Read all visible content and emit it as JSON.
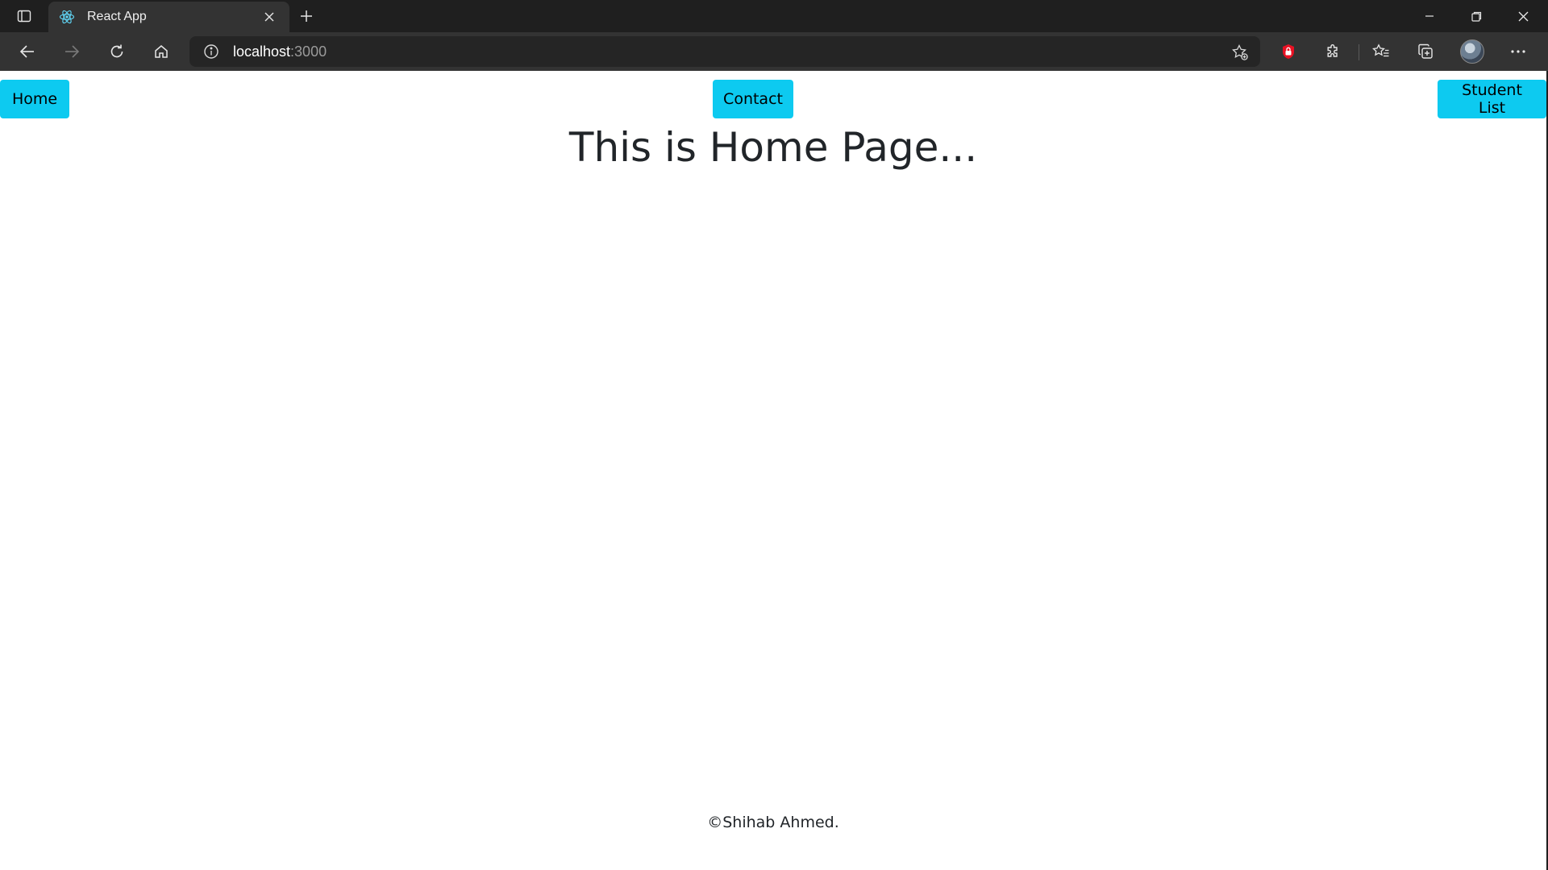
{
  "browser": {
    "tab": {
      "title": "React App",
      "favicon": "react-logo-icon"
    },
    "address": {
      "host": "localhost",
      "port": ":3000"
    },
    "icons": {
      "tab_actions": "tab-actions-icon",
      "new_tab": "plus-icon",
      "back": "arrow-left-icon",
      "forward": "arrow-right-icon",
      "refresh": "refresh-icon",
      "home": "home-icon",
      "site_info": "info-icon",
      "add_favorite": "star-add-icon",
      "extension_lock": "lock-icon",
      "extensions": "puzzle-icon",
      "favorites": "favorites-icon",
      "collections": "collections-icon",
      "more": "more-icon"
    }
  },
  "nav": {
    "home_label": "Home",
    "contact_label": "Contact",
    "students_label": "Student List"
  },
  "main": {
    "heading": "This is Home Page..."
  },
  "footer": {
    "text": "©Shihab Ahmed."
  },
  "colors": {
    "button_bg": "#0dcaf0",
    "chrome_dark": "#1f1f1f",
    "toolbar": "#333333"
  }
}
